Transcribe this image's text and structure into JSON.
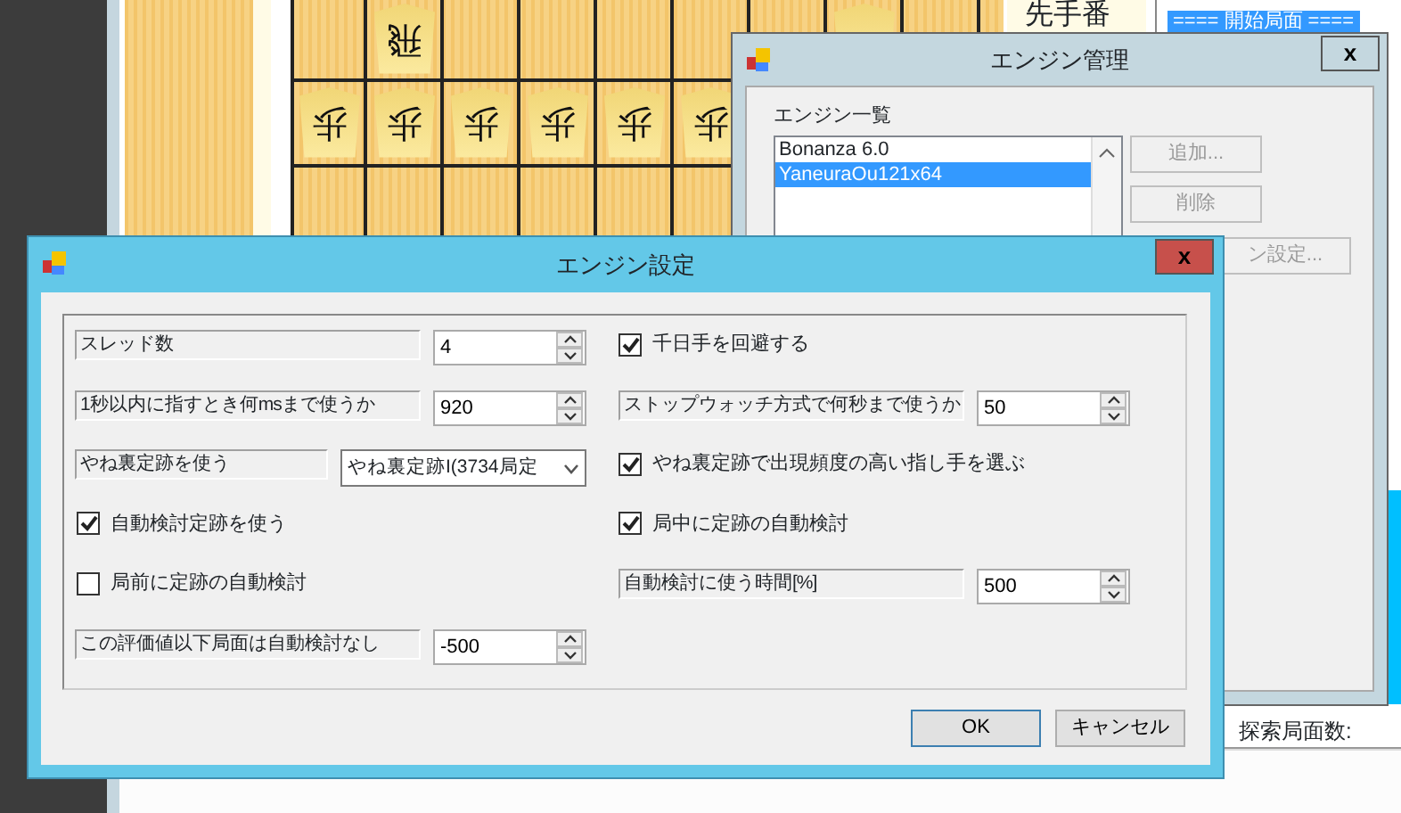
{
  "board": {
    "rows": [
      {
        "squares": [
          {
            "occupied": false
          },
          {
            "occupied": true,
            "piece": "飛"
          },
          {
            "occupied": false
          },
          {
            "occupied": false
          },
          {
            "occupied": false
          },
          {
            "occupied": false
          },
          {
            "occupied": false
          },
          {
            "occupied": true
          }
        ]
      },
      {
        "squares": [
          {
            "occupied": true,
            "piece": "歩"
          },
          {
            "occupied": true,
            "piece": "歩"
          },
          {
            "occupied": true,
            "piece": "歩"
          },
          {
            "occupied": true,
            "piece": "歩"
          },
          {
            "occupied": true,
            "piece": "歩"
          },
          {
            "occupied": true,
            "piece": "歩"
          }
        ]
      }
    ],
    "turn": "先手番",
    "moves": [
      {
        "text": "==== 開始局面 ====",
        "selected": true
      }
    ],
    "search_nodes_label": "探索局面数:"
  },
  "engine_manager": {
    "title": "エンジン管理",
    "close": "x",
    "list_label": "エンジン一覧",
    "engines": [
      {
        "name": "Bonanza 6.0",
        "selected": false
      },
      {
        "name": "YaneuraOu121x64",
        "selected": true
      }
    ],
    "buttons": [
      {
        "label": "追加...",
        "disabled": true
      },
      {
        "label": "削除",
        "disabled": true
      },
      {
        "label": "ン設定...",
        "disabled": true
      }
    ]
  },
  "engine_settings": {
    "title": "エンジン設定",
    "close": "x",
    "rows": [
      {
        "left": {
          "kind": "spin",
          "label": "スレッド数",
          "value": "4"
        },
        "right": {
          "kind": "checkbox",
          "label": "千日手を回避する",
          "checked": true
        }
      },
      {
        "left": {
          "kind": "spin",
          "label": "1秒以内に指すとき何msまで使うか",
          "value": "920"
        },
        "right": {
          "kind": "spin",
          "label": "ストップウォッチ方式で何秒まで使うか",
          "value": "50"
        }
      },
      {
        "left": {
          "kind": "combo",
          "label": "やね裏定跡を使う",
          "value": "やね裏定跡I(3734局定"
        },
        "right": {
          "kind": "checkbox",
          "label": "やね裏定跡で出現頻度の高い指し手を選ぶ",
          "checked": true
        }
      },
      {
        "left": {
          "kind": "checkbox",
          "label": "自動検討定跡を使う",
          "checked": true
        },
        "right": {
          "kind": "checkbox",
          "label": "局中に定跡の自動検討",
          "checked": true
        }
      },
      {
        "left": {
          "kind": "checkbox",
          "label": "局前に定跡の自動検討",
          "checked": false
        },
        "right": {
          "kind": "spin",
          "label": "自動検討に使う時間[%]",
          "value": "500"
        }
      },
      {
        "left": {
          "kind": "spin",
          "label": "この評価値以下局面は自動検討なし",
          "value": "-500"
        }
      }
    ],
    "buttons": [
      {
        "label": "OK",
        "default": true
      },
      {
        "label": "キャンセル",
        "default": false
      }
    ]
  }
}
